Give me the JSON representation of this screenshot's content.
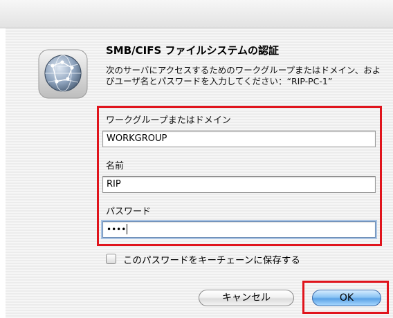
{
  "dialog": {
    "title": "SMB/CIFS ファイルシステムの認証",
    "description": "次のサーバにアクセスするためのワークグループまたはドメイン、およびユーザ名とパスワードを入力してください：“RIP-PC-1”",
    "app_icon": "network-globe-icon"
  },
  "fields": {
    "workgroup_label": "ワークグループまたはドメイン",
    "workgroup_value": "WORKGROUP",
    "name_label": "名前",
    "name_value": "RIP",
    "password_label": "パスワード",
    "password_value": "••••"
  },
  "keychain": {
    "label": "このパスワードをキーチェーンに保存する",
    "checked": false
  },
  "buttons": {
    "cancel": "キャンセル",
    "ok": "OK"
  },
  "colors": {
    "highlight_red": "#e0141c",
    "default_button_blue": "#5ba2e6"
  }
}
